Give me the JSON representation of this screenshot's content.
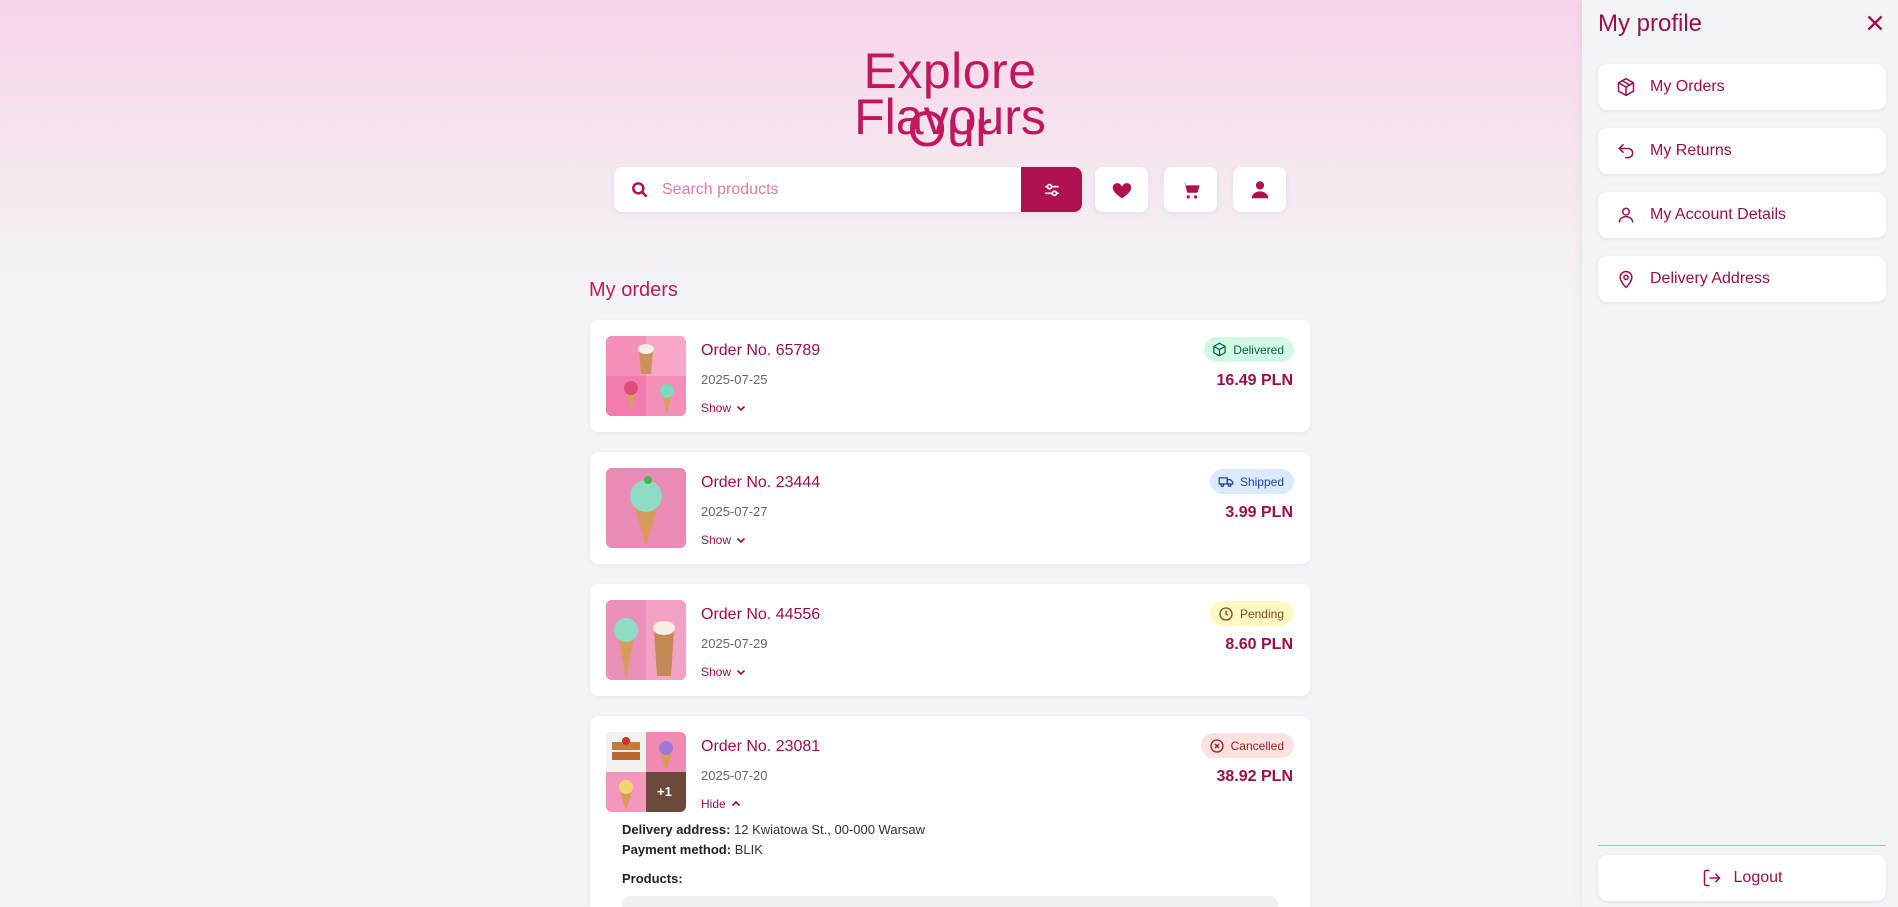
{
  "hero": {
    "line1": "Explore Our",
    "line2": "Flavours"
  },
  "search": {
    "placeholder": "Search products",
    "value": ""
  },
  "header_icons": [
    "search-icon",
    "filter-icon",
    "heart-icon",
    "cart-icon",
    "user-icon"
  ],
  "orders_section": {
    "title": "My orders",
    "orders": [
      {
        "number": "Order No. 65789",
        "date": "2025-07-25",
        "toggle": "Show",
        "status": "Delivered",
        "price": "16.49 PLN"
      },
      {
        "number": "Order No. 23444",
        "date": "2025-07-27",
        "toggle": "Show",
        "status": "Shipped",
        "price": "3.99 PLN"
      },
      {
        "number": "Order No. 44556",
        "date": "2025-07-29",
        "toggle": "Show",
        "status": "Pending",
        "price": "8.60 PLN"
      },
      {
        "number": "Order No. 23081",
        "date": "2025-07-20",
        "toggle": "Hide",
        "status": "Cancelled",
        "price": "38.92 PLN",
        "extra_count": "+1",
        "delivery_label": "Delivery address:",
        "delivery_value": "12 Kwiatowa St., 00-000 Warsaw",
        "payment_label": "Payment method:",
        "payment_value": "BLIK",
        "products_label": "Products:"
      }
    ]
  },
  "status_colors": {
    "Delivered": {
      "bg": "#d1fae5",
      "fg": "#065f46"
    },
    "Shipped": {
      "bg": "#dbeafe",
      "fg": "#1e40af"
    },
    "Pending": {
      "bg": "#fef9c3",
      "fg": "#854d0e"
    },
    "Cancelled": {
      "bg": "#fee2e2",
      "fg": "#991b1b"
    }
  },
  "profile_panel": {
    "title": "My profile",
    "items": [
      {
        "label": "My Orders",
        "icon": "box-icon"
      },
      {
        "label": "My Returns",
        "icon": "return-icon"
      },
      {
        "label": "My Account Details",
        "icon": "user-icon"
      },
      {
        "label": "Delivery Address",
        "icon": "location-pin-icon"
      }
    ],
    "logout": "Logout"
  },
  "colors": {
    "brand": "#b0124f",
    "brand_text": "#9d0f4a",
    "hero_text": "#c2185b"
  }
}
